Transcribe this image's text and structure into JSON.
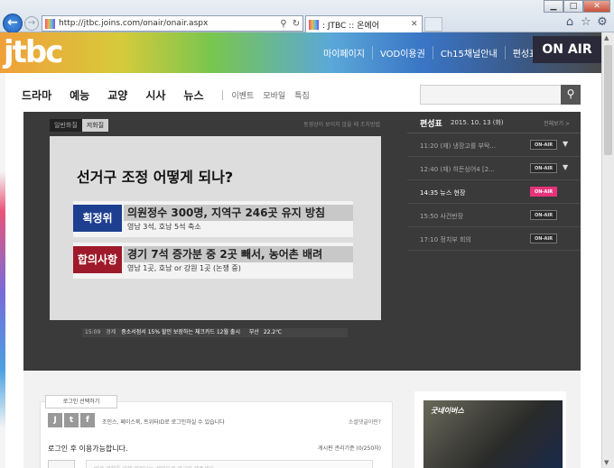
{
  "browser": {
    "url": "http://jtbc.joins.com/onair/onair.aspx",
    "tab_label": ": JTBC :: 온에어",
    "win_min": "▁",
    "win_max": "□",
    "win_close": "✕"
  },
  "header": {
    "logo": "jtbc",
    "nav": [
      "마이페이지",
      "VOD이용권",
      "Ch15채널안내",
      "편성표"
    ],
    "onair": "ON AIR"
  },
  "mainnav": {
    "big": [
      "드라마",
      "예능",
      "교양",
      "시사",
      "뉴스"
    ],
    "small": [
      "이벤트",
      "모바일",
      "특집"
    ]
  },
  "player": {
    "quality": [
      "일반화질",
      "저화질"
    ],
    "help": "동영상이 보이지 않을 때 조치방법",
    "headline": "선거구 조정 어떻게 되나?",
    "box1": {
      "tag": "획정위",
      "headline": "의원정수 300명, 지역구 246곳 유지 방침",
      "sub": "영남 3석, 호남 5석 축소",
      "tag_color": "#1e3f8f"
    },
    "box2": {
      "tag": "합의사항",
      "headline": "경기 7석 증가분 중 2곳 빼서, 농어촌 배려",
      "sub": "영남 1곳, 호남 or 강원 1곳 (논쟁 중)",
      "tag_color": "#9e1a2a"
    },
    "ticker": {
      "time": "15:09",
      "cat": "경제",
      "text": "중소서점서 15% 할인 보장하는 체크카드 12월 출시",
      "region": "부산",
      "temp": "22.2℃"
    }
  },
  "schedule": {
    "title": "편성표",
    "date": "2015. 10. 13 (화)",
    "all": "전체보기 >",
    "items": [
      {
        "text": "11:20 (재) 냉장고를 부탁...",
        "badge": "ON-AIR",
        "live": false,
        "chev": true
      },
      {
        "text": "12:40 (재) 히든싱어4 [2...",
        "badge": "ON-AIR",
        "live": false,
        "chev": true
      },
      {
        "text": "14:35 뉴스 현장",
        "badge": "ON-AIR",
        "live": true,
        "chev": false
      },
      {
        "text": "15:50 사건반장",
        "badge": "ON-AIR",
        "live": false,
        "chev": false
      },
      {
        "text": "17:10 정치부 회의",
        "badge": "ON-AIR",
        "live": false,
        "chev": false
      }
    ]
  },
  "comments": {
    "login_tab": "로그인 선택하기",
    "social_note": "조인스, 페이스북, 트위터ID로 로그인하실 수 있습니다",
    "help": "소셜댓글이란?",
    "login_req": "로그인 후 이용가능합니다.",
    "counter": "게시판 관리기준 (0/250자)",
    "placeholder": "비건 견해을 위해 회원님는 게외으로 로그인 해주세요."
  },
  "ad": {
    "caption": "굿네이버스"
  }
}
